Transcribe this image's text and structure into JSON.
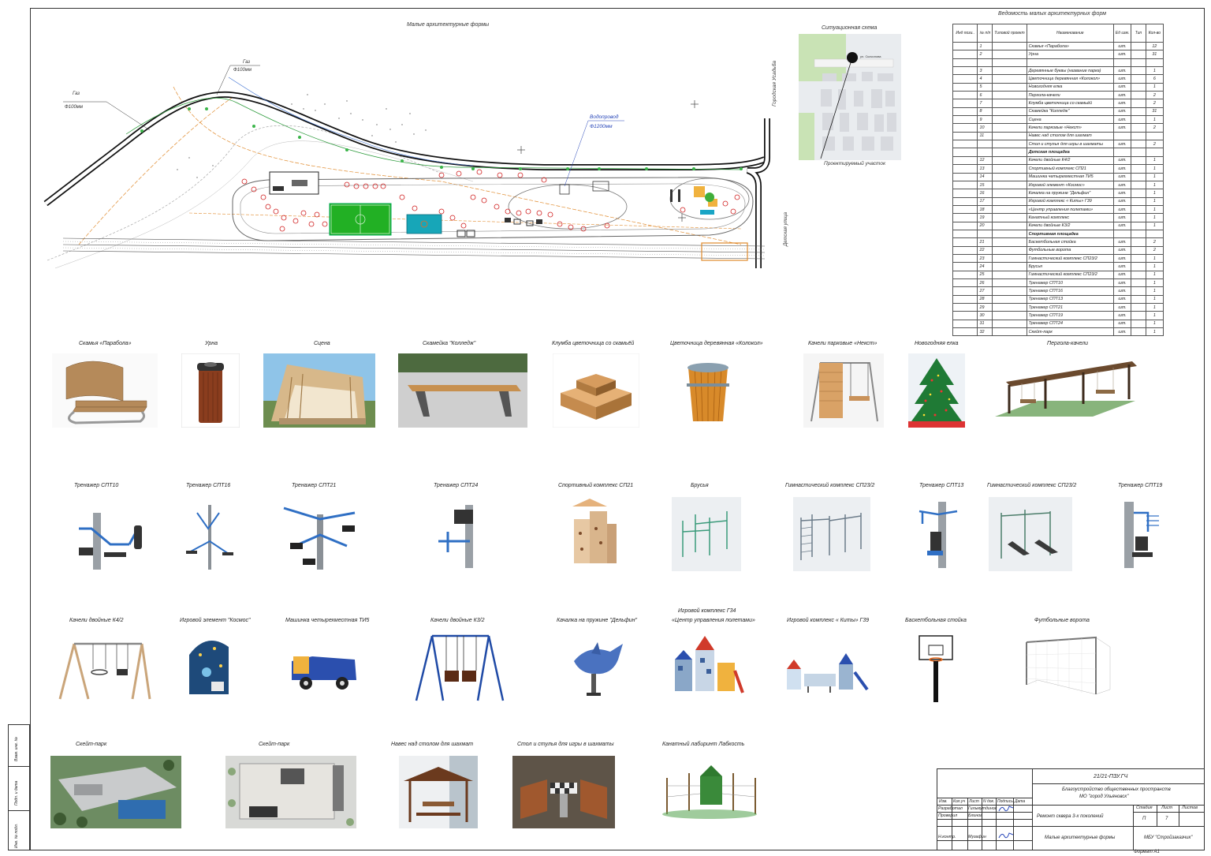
{
  "sheet": {
    "plan_title": "Малые архитектурные формы",
    "situation_title": "Ситуационная схема",
    "situation_label_site": "Проектируемый участок",
    "situation_label_street": "ул. Скочилова",
    "plan_labels": {
      "gas1": "Газ",
      "gas1_d": "Ф100мм",
      "gas2": "Газ",
      "gas2_d": "Ф100мм",
      "water": "Водопровод",
      "water_d": "Ф1200мм",
      "road_right": "Городская Усадьба",
      "road_right2": "Детская улица"
    }
  },
  "schedule": {
    "title": "Ведомость малых архитектурных форм",
    "headers": [
      "Инд пози..",
      "№ п/п",
      "Типовой проект",
      "Наименование",
      "Ед изм.",
      "Тип",
      "Кол-во"
    ],
    "rows": [
      {
        "n": "1",
        "name": "Скамья «Парабола»",
        "unit": "шт.",
        "qty": "12"
      },
      {
        "n": "2",
        "name": "Урна",
        "unit": "шт.",
        "qty": "31"
      },
      {
        "n": "",
        "name": "",
        "unit": "",
        "qty": ""
      },
      {
        "n": "3",
        "name": "Деревянные буквы (название парка)",
        "unit": "шт.",
        "qty": "1"
      },
      {
        "n": "4",
        "name": "Цветочница деревянная «Колокол»",
        "unit": "шт.",
        "qty": "6"
      },
      {
        "n": "5",
        "name": "Новогодняя елка",
        "unit": "шт.",
        "qty": "1"
      },
      {
        "n": "6",
        "name": "Пергола-качели",
        "unit": "шт.",
        "qty": "2"
      },
      {
        "n": "7",
        "name": "Клумба цветочница со скамьёй",
        "unit": "шт.",
        "qty": "2"
      },
      {
        "n": "8",
        "name": "Скамейка \"Колледж\"",
        "unit": "шт.",
        "qty": "31"
      },
      {
        "n": "9",
        "name": "Сцена",
        "unit": "шт.",
        "qty": "1"
      },
      {
        "n": "10",
        "name": "Качели парковые «Некст»",
        "unit": "шт.",
        "qty": "2"
      },
      {
        "n": "11",
        "name": "Навес над столом для шахмат",
        "unit": "",
        "qty": ""
      },
      {
        "n": "",
        "name": "Стол и стулья для игры в шахматы",
        "unit": "шт.",
        "qty": "2"
      },
      {
        "n": "",
        "name": "Детская площадка",
        "unit": "",
        "qty": "",
        "section": true
      },
      {
        "n": "12",
        "name": "Качели двойные К4/2",
        "unit": "шт.",
        "qty": "1"
      },
      {
        "n": "13",
        "name": "Спортивный комплекс СП21",
        "unit": "шт.",
        "qty": "1"
      },
      {
        "n": "14",
        "name": "Машинка четырехместная ТИ5",
        "unit": "шт.",
        "qty": "1"
      },
      {
        "n": "15",
        "name": "Игровой элемент «Космос»",
        "unit": "шт.",
        "qty": "1"
      },
      {
        "n": "16",
        "name": "Качалка на пружине \"Дельфин\"",
        "unit": "шт.",
        "qty": "1"
      },
      {
        "n": "17",
        "name": "Игровой комплекс « Киты» Г39",
        "unit": "шт.",
        "qty": "1"
      },
      {
        "n": "18",
        "name": "«Центр управления полетами»",
        "unit": "шт.",
        "qty": "1"
      },
      {
        "n": "19",
        "name": "Канатный комплекс",
        "unit": "шт.",
        "qty": "1"
      },
      {
        "n": "20",
        "name": "Качели двойные К3/2",
        "unit": "шт.",
        "qty": "1"
      },
      {
        "n": "",
        "name": "Спортивная площадка",
        "unit": "",
        "qty": "",
        "section": true
      },
      {
        "n": "21",
        "name": "Баскетбольная стойка",
        "unit": "шт.",
        "qty": "2"
      },
      {
        "n": "22",
        "name": "Футбольные ворота",
        "unit": "шт.",
        "qty": "2"
      },
      {
        "n": "23",
        "name": "Гимнастический комплекс СП23/2",
        "unit": "шт.",
        "qty": "1"
      },
      {
        "n": "24",
        "name": "Брусья",
        "unit": "шт.",
        "qty": "1"
      },
      {
        "n": "25",
        "name": "Гимнастический комплекс СП23/2",
        "unit": "шт.",
        "qty": "1"
      },
      {
        "n": "26",
        "name": "Тренажер СПТ10",
        "unit": "шт.",
        "qty": "1"
      },
      {
        "n": "27",
        "name": "Тренажер СПТ16",
        "unit": "шт.",
        "qty": "1"
      },
      {
        "n": "28",
        "name": "Тренажер СПТ13",
        "unit": "шт.",
        "qty": "1"
      },
      {
        "n": "29",
        "name": "Тренажер СПТ21",
        "unit": "шт.",
        "qty": "1"
      },
      {
        "n": "30",
        "name": "Тренажер СПТ19",
        "unit": "шт.",
        "qty": "1"
      },
      {
        "n": "31",
        "name": "Тренажер СПТ24",
        "unit": "шт.",
        "qty": "1"
      },
      {
        "n": "32",
        "name": "Скейт-парк",
        "unit": "шт.",
        "qty": "1"
      }
    ]
  },
  "items_row1": [
    "Скамья «Парабола»",
    "Урна",
    "Сцена",
    "Скамейка  \"Колледж\"",
    "Клумба цветочница со скамьёй",
    "Цветочница деревянная «Колокол»",
    "Качели парковые «Некст»",
    "Новогодняя елка",
    "Пергола-качели"
  ],
  "items_row2": [
    "Тренажер СПТ10",
    "Тренажер СПТ16",
    "Тренажер СПТ21",
    "Тренажер СПТ24",
    "Спортивный комплекс СП21",
    "Брусья",
    "Гимнастический комплекс СП23/2",
    "Тренажер СПТ13",
    "Гимнастический комплекс СП23/2",
    "Тренажер СПТ19"
  ],
  "items_row3": [
    "Качели двойные К4/2",
    "Игровой элемент \"Космос\"",
    "Машинка четырехместная ТИ5",
    "Качели двойные К3/2",
    "Качалка на пружине \"Дельфин\"",
    "«Центр управления полетами»",
    "Игровой комплекс « Киты» Г39",
    "Баскетбольная стойка",
    "Футбольные ворота"
  ],
  "item_row3_top": "Игровой комплекс Г34",
  "items_row4": [
    "Скейт-парк",
    "Скейт-парк",
    "Навес над столом для шахмат",
    "Стол и стулья для игры в шахматы",
    "Канатный лабиринт Лабкость"
  ],
  "left_stamp": [
    "Взам. инв. №",
    "Подп. и дата",
    "Инв. № подл."
  ],
  "title_block": {
    "code": "21/21-ПЗУ.ГЧ",
    "project_line1": "Благоустройство общественных пространств",
    "project_line2": "МО \"город Ульяновск\"",
    "object": "Ремонт сквера 3-х поколений",
    "sheet_name": "Малые архитектурные формы",
    "org": "МБУ \"Стройзаказчик\"",
    "header_cells": [
      "Изм.",
      "Кол.уч",
      "Лист",
      "N док.",
      "Подпись",
      "Дата"
    ],
    "roles": [
      {
        "role": "Разработал",
        "name": "Гильмутдинов"
      },
      {
        "role": "Проверил",
        "name": "Блинов"
      },
      {
        "role": "",
        "name": ""
      },
      {
        "role": "Н.контр.",
        "name": "Музафин"
      }
    ],
    "stage_label": "Стадия",
    "sheet_label": "Лист",
    "sheets_label": "Листов",
    "stage": "П",
    "sheet": "7",
    "format": "Формат А1"
  }
}
